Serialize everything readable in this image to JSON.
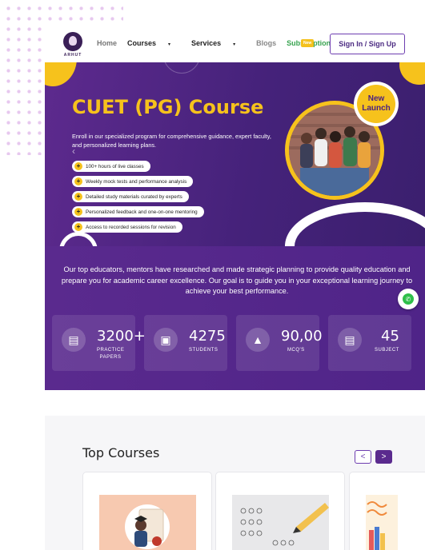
{
  "header": {
    "logo_text": "ARHUT",
    "nav": {
      "home": "Home",
      "courses": "Courses",
      "services": "Services",
      "blogs": "Blogs",
      "subscription": "Subscription",
      "new_badge": "New"
    },
    "signin_label": "Sign In / Sign Up"
  },
  "hero": {
    "title": "CUET (PG) Course",
    "description": "Enroll in our specialized program for comprehensive guidance, expert faculty, and personalized learning plans.",
    "features": [
      "100+ hours of live classes",
      "Weekly mock tests and performance analysis",
      "Detailed study materials curated by experts",
      "Personalized feedback and one-on-one mentoring",
      "Access to recorded sessions for revision"
    ],
    "badge": "New Launch",
    "prev_arrow": "‹"
  },
  "info": {
    "text": "Our top educators, mentors have researched and made strategic planning to provide quality education and prepare you for academic career excellence. Our goal is to guide you in your exceptional learning journey to achieve your best performance.",
    "stats": [
      {
        "value": "3200+",
        "label": "PRACTICE PAPERS",
        "icon": "papers-icon"
      },
      {
        "value": "4275",
        "label": "STUDENTS",
        "icon": "students-icon"
      },
      {
        "value": "90,00",
        "label": "MCQ'S",
        "icon": "rocket-icon"
      },
      {
        "value": "45",
        "label": "SUBJECT",
        "icon": "subject-icon"
      }
    ]
  },
  "top_courses": {
    "title": "Top Courses",
    "prev": "<",
    "next": ">"
  },
  "colors": {
    "brand_purple": "#5a2a8e",
    "accent_yellow": "#f6c21c",
    "subscription_green": "#37a34f"
  }
}
